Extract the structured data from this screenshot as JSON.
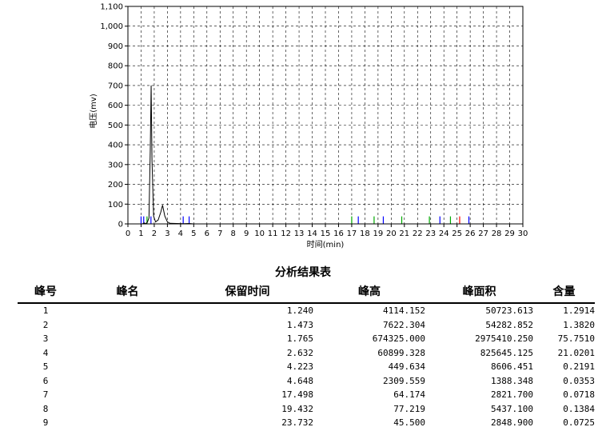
{
  "chart_data": {
    "type": "line",
    "title": "",
    "xlabel": "时间(min)",
    "ylabel": "电压(mv)",
    "xlim": [
      0,
      30
    ],
    "ylim": [
      0,
      1100
    ],
    "x_ticks": [
      "0",
      "1",
      "2",
      "3",
      "4",
      "5",
      "6",
      "7",
      "8",
      "9",
      "10",
      "11",
      "12",
      "13",
      "14",
      "15",
      "16",
      "17",
      "18",
      "19",
      "20",
      "21",
      "22",
      "23",
      "24",
      "25",
      "26",
      "27",
      "28",
      "29",
      "30"
    ],
    "y_ticks": [
      "0",
      "100",
      "200",
      "300",
      "400",
      "500",
      "600",
      "700",
      "800",
      "900",
      "1,000",
      "1,100"
    ],
    "grid": true,
    "series": [
      {
        "x": [
          0,
          1.1,
          1.24,
          1.35,
          1.473,
          1.6,
          1.7,
          1.765,
          1.83,
          1.95,
          2.1,
          2.3,
          2.5,
          2.632,
          2.8,
          3.0,
          3.2,
          4.223,
          4.648,
          5.0,
          30
        ],
        "y": [
          0,
          0,
          5,
          1,
          8,
          30,
          380,
          700,
          320,
          40,
          10,
          20,
          60,
          95,
          40,
          10,
          3,
          1,
          2,
          0,
          0
        ]
      }
    ],
    "marker_colors": [
      "#0000ff",
      "#00aa00",
      "#ff0000"
    ],
    "markers": [
      {
        "x": 1.0,
        "c": 0
      },
      {
        "x": 1.2,
        "c": 0
      },
      {
        "x": 1.45,
        "c": 1
      },
      {
        "x": 1.75,
        "c": 0
      },
      {
        "x": 4.2,
        "c": 0
      },
      {
        "x": 4.65,
        "c": 0
      },
      {
        "x": 17.0,
        "c": 1
      },
      {
        "x": 17.5,
        "c": 0
      },
      {
        "x": 18.7,
        "c": 1
      },
      {
        "x": 19.4,
        "c": 0
      },
      {
        "x": 20.8,
        "c": 1
      },
      {
        "x": 22.9,
        "c": 1
      },
      {
        "x": 23.7,
        "c": 0
      },
      {
        "x": 24.5,
        "c": 1
      },
      {
        "x": 25.2,
        "c": 2
      },
      {
        "x": 25.9,
        "c": 0
      }
    ]
  },
  "report": {
    "title": "分析结果表",
    "headers": {
      "no": "峰号",
      "name": "峰名",
      "rt": "保留时间",
      "height": "峰高",
      "area": "峰面积",
      "pct": "含量"
    },
    "rows": [
      {
        "no": "1",
        "name": "",
        "rt": "1.240",
        "height": "4114.152",
        "area": "50723.613",
        "pct": "1.2914"
      },
      {
        "no": "2",
        "name": "",
        "rt": "1.473",
        "height": "7622.304",
        "area": "54282.852",
        "pct": "1.3820"
      },
      {
        "no": "3",
        "name": "",
        "rt": "1.765",
        "height": "674325.000",
        "area": "2975410.250",
        "pct": "75.7510"
      },
      {
        "no": "4",
        "name": "",
        "rt": "2.632",
        "height": "60899.328",
        "area": "825645.125",
        "pct": "21.0201"
      },
      {
        "no": "5",
        "name": "",
        "rt": "4.223",
        "height": "449.634",
        "area": "8606.451",
        "pct": "0.2191"
      },
      {
        "no": "6",
        "name": "",
        "rt": "4.648",
        "height": "2309.559",
        "area": "1388.348",
        "pct": "0.0353"
      },
      {
        "no": "7",
        "name": "",
        "rt": "17.498",
        "height": "64.174",
        "area": "2821.700",
        "pct": "0.0718"
      },
      {
        "no": "8",
        "name": "",
        "rt": "19.432",
        "height": "77.219",
        "area": "5437.100",
        "pct": "0.1384"
      },
      {
        "no": "9",
        "name": "",
        "rt": "23.732",
        "height": "45.500",
        "area": "2848.900",
        "pct": "0.0725"
      }
    ]
  }
}
